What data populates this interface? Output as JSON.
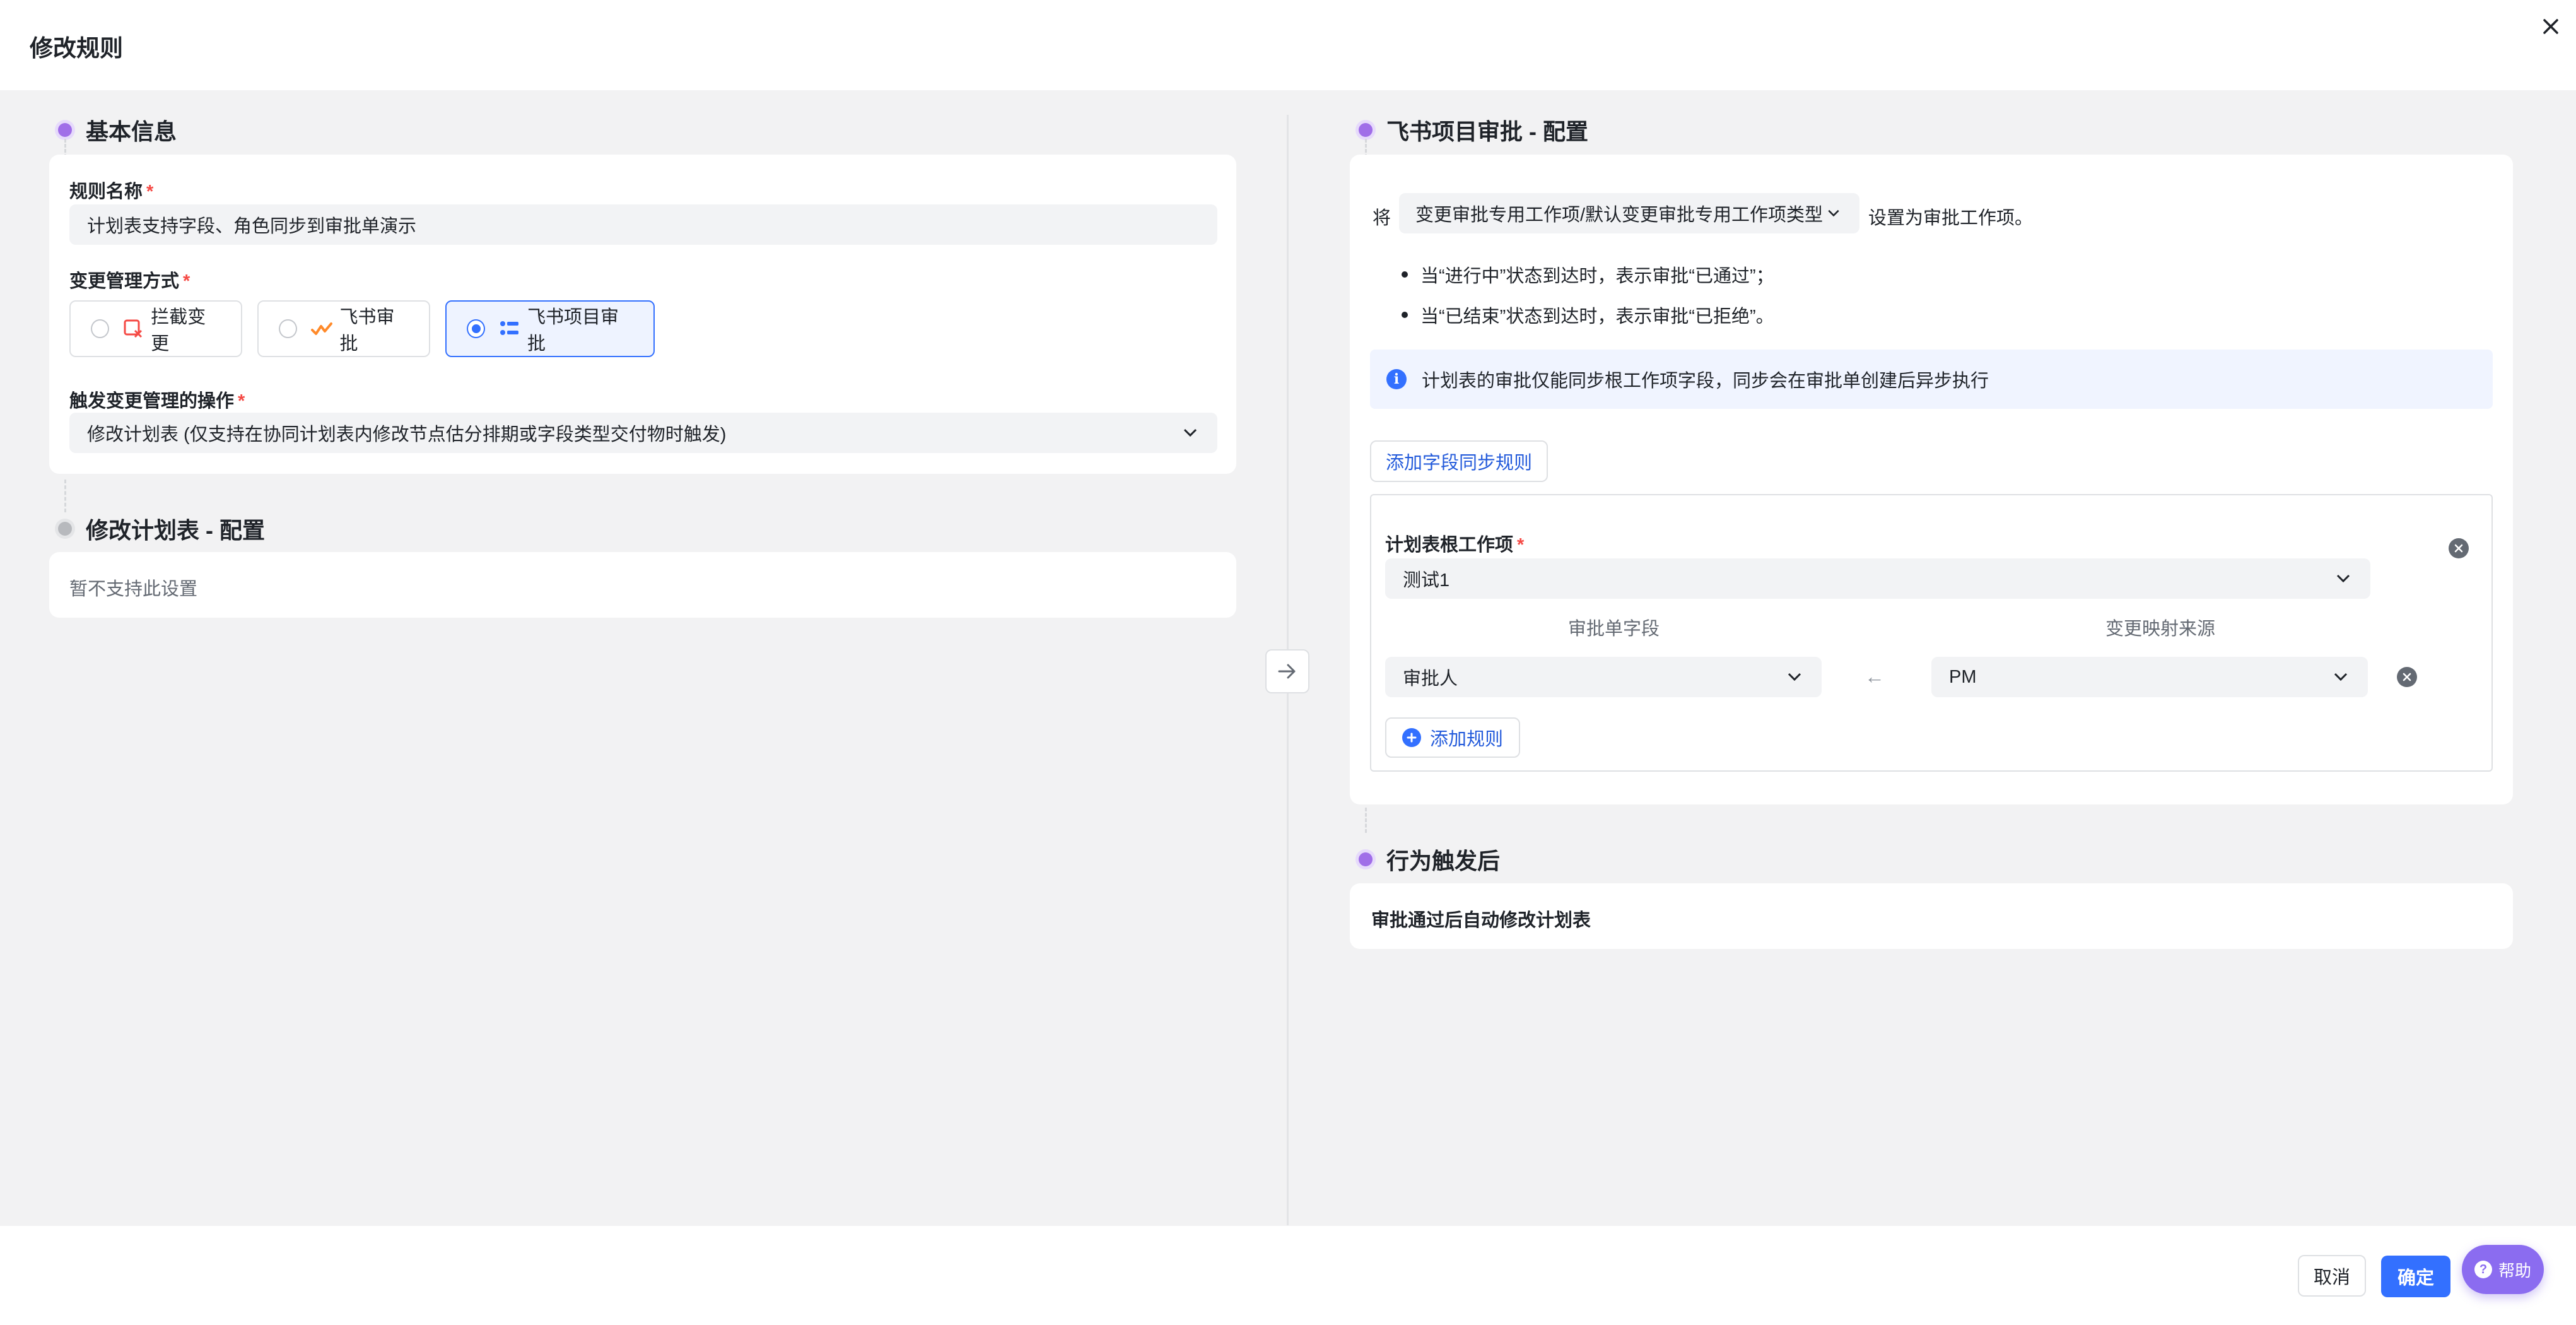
{
  "modal": {
    "title": "修改规则"
  },
  "basic": {
    "title": "基本信息",
    "rule_name_label": "规则名称",
    "rule_name_value": "计划表支持字段、角色同步到审批单演示",
    "mode_label": "变更管理方式",
    "options": [
      "拦截变更",
      "飞书审批",
      "飞书项目审批"
    ],
    "trigger_label": "触发变更管理的操作",
    "trigger_value": "修改计划表 (仅支持在协同计划表内修改节点估分排期或字段类型交付物时触发)",
    "required_mark": "*"
  },
  "plan": {
    "title": "修改计划表 - 配置",
    "note": "暂不支持此设置"
  },
  "approval": {
    "title": "飞书项目审批 - 配置",
    "prefix": "将",
    "work_item_type": "变更审批专用工作项/默认变更审批专用工作项类型",
    "suffix": "设置为审批工作项。",
    "bullets": [
      "当“进行中”状态到达时，表示审批“已通过”；",
      "当“已结束”状态到达时，表示审批“已拒绝”。"
    ],
    "info": "计划表的审批仅能同步根工作项字段，同步会在审批单创建后异步执行",
    "add_sync_rule": "添加字段同步规则",
    "root_item_label": "计划表根工作项",
    "root_item_value": "测试1",
    "col_field": "审批单字段",
    "col_source": "变更映射来源",
    "field_value": "审批人",
    "arrow": "←",
    "source_value": "PM",
    "add_rule": "添加规则"
  },
  "after": {
    "title": "行为触发后",
    "text": "审批通过后自动修改计划表"
  },
  "footer": {
    "cancel": "取消",
    "ok": "确定",
    "help": "帮助"
  },
  "colors": {
    "primary": "#3370ff",
    "accent": "#a06ee8",
    "required": "#f54a45"
  }
}
